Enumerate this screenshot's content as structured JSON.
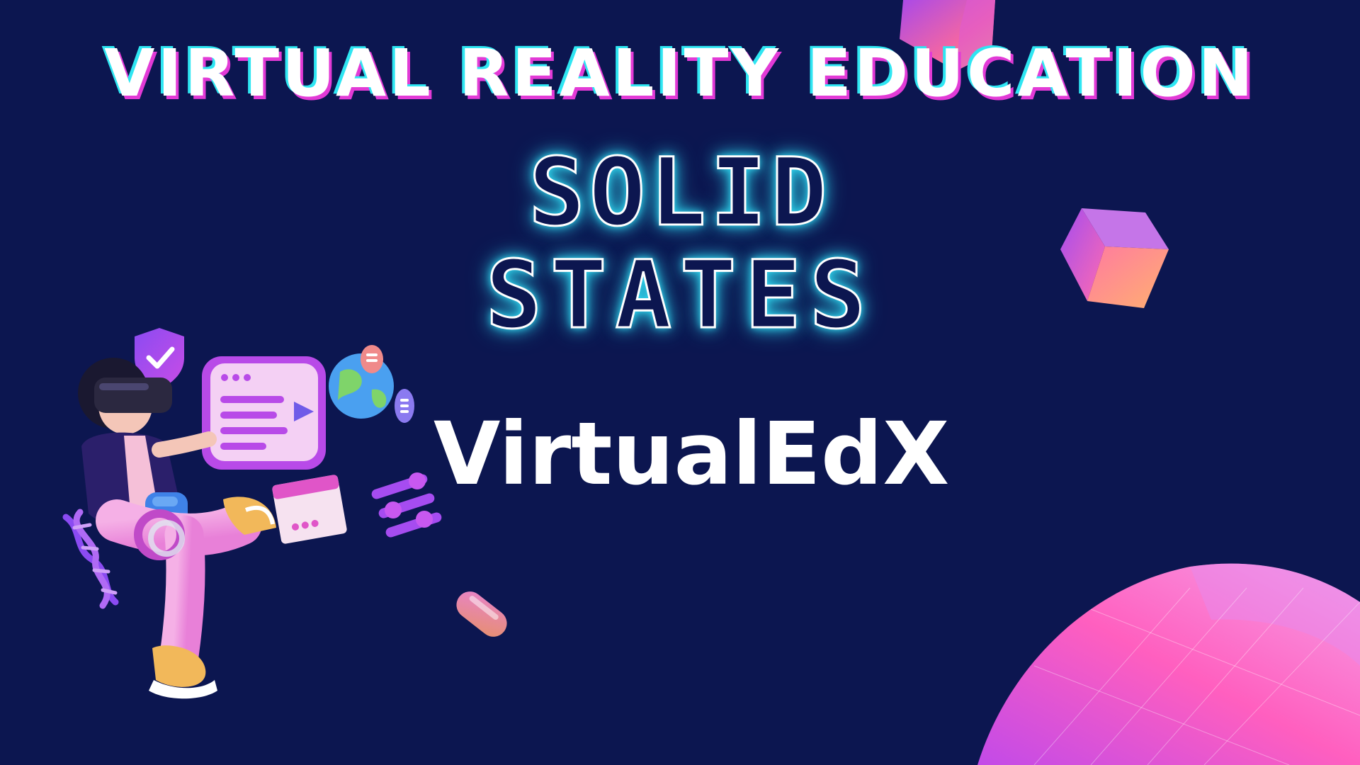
{
  "headline": "VIRTUAL REALITY EDUCATION",
  "neon_title": {
    "line1": "SOLID",
    "line2": "STATES"
  },
  "brand": "VirtualEdX",
  "colors": {
    "background": "#0c1650",
    "text": "#ffffff",
    "headline_shadow_cyan": "#2fe6f2",
    "headline_shadow_magenta": "#e23ad6",
    "neon_glow": "#2fd8f0",
    "accent_purple": "#b040e8",
    "accent_pink": "#ff5fb0"
  },
  "decorations": [
    "vr-student-illustration",
    "shield-check-icon",
    "browser-window-icon",
    "globe-icon",
    "chat-bubble-icon",
    "dna-helix-icon",
    "slider-controls-icon",
    "photo-card-icon",
    "glass-cube-icon",
    "glass-capsule-icon",
    "glass-cylinder-icon"
  ]
}
